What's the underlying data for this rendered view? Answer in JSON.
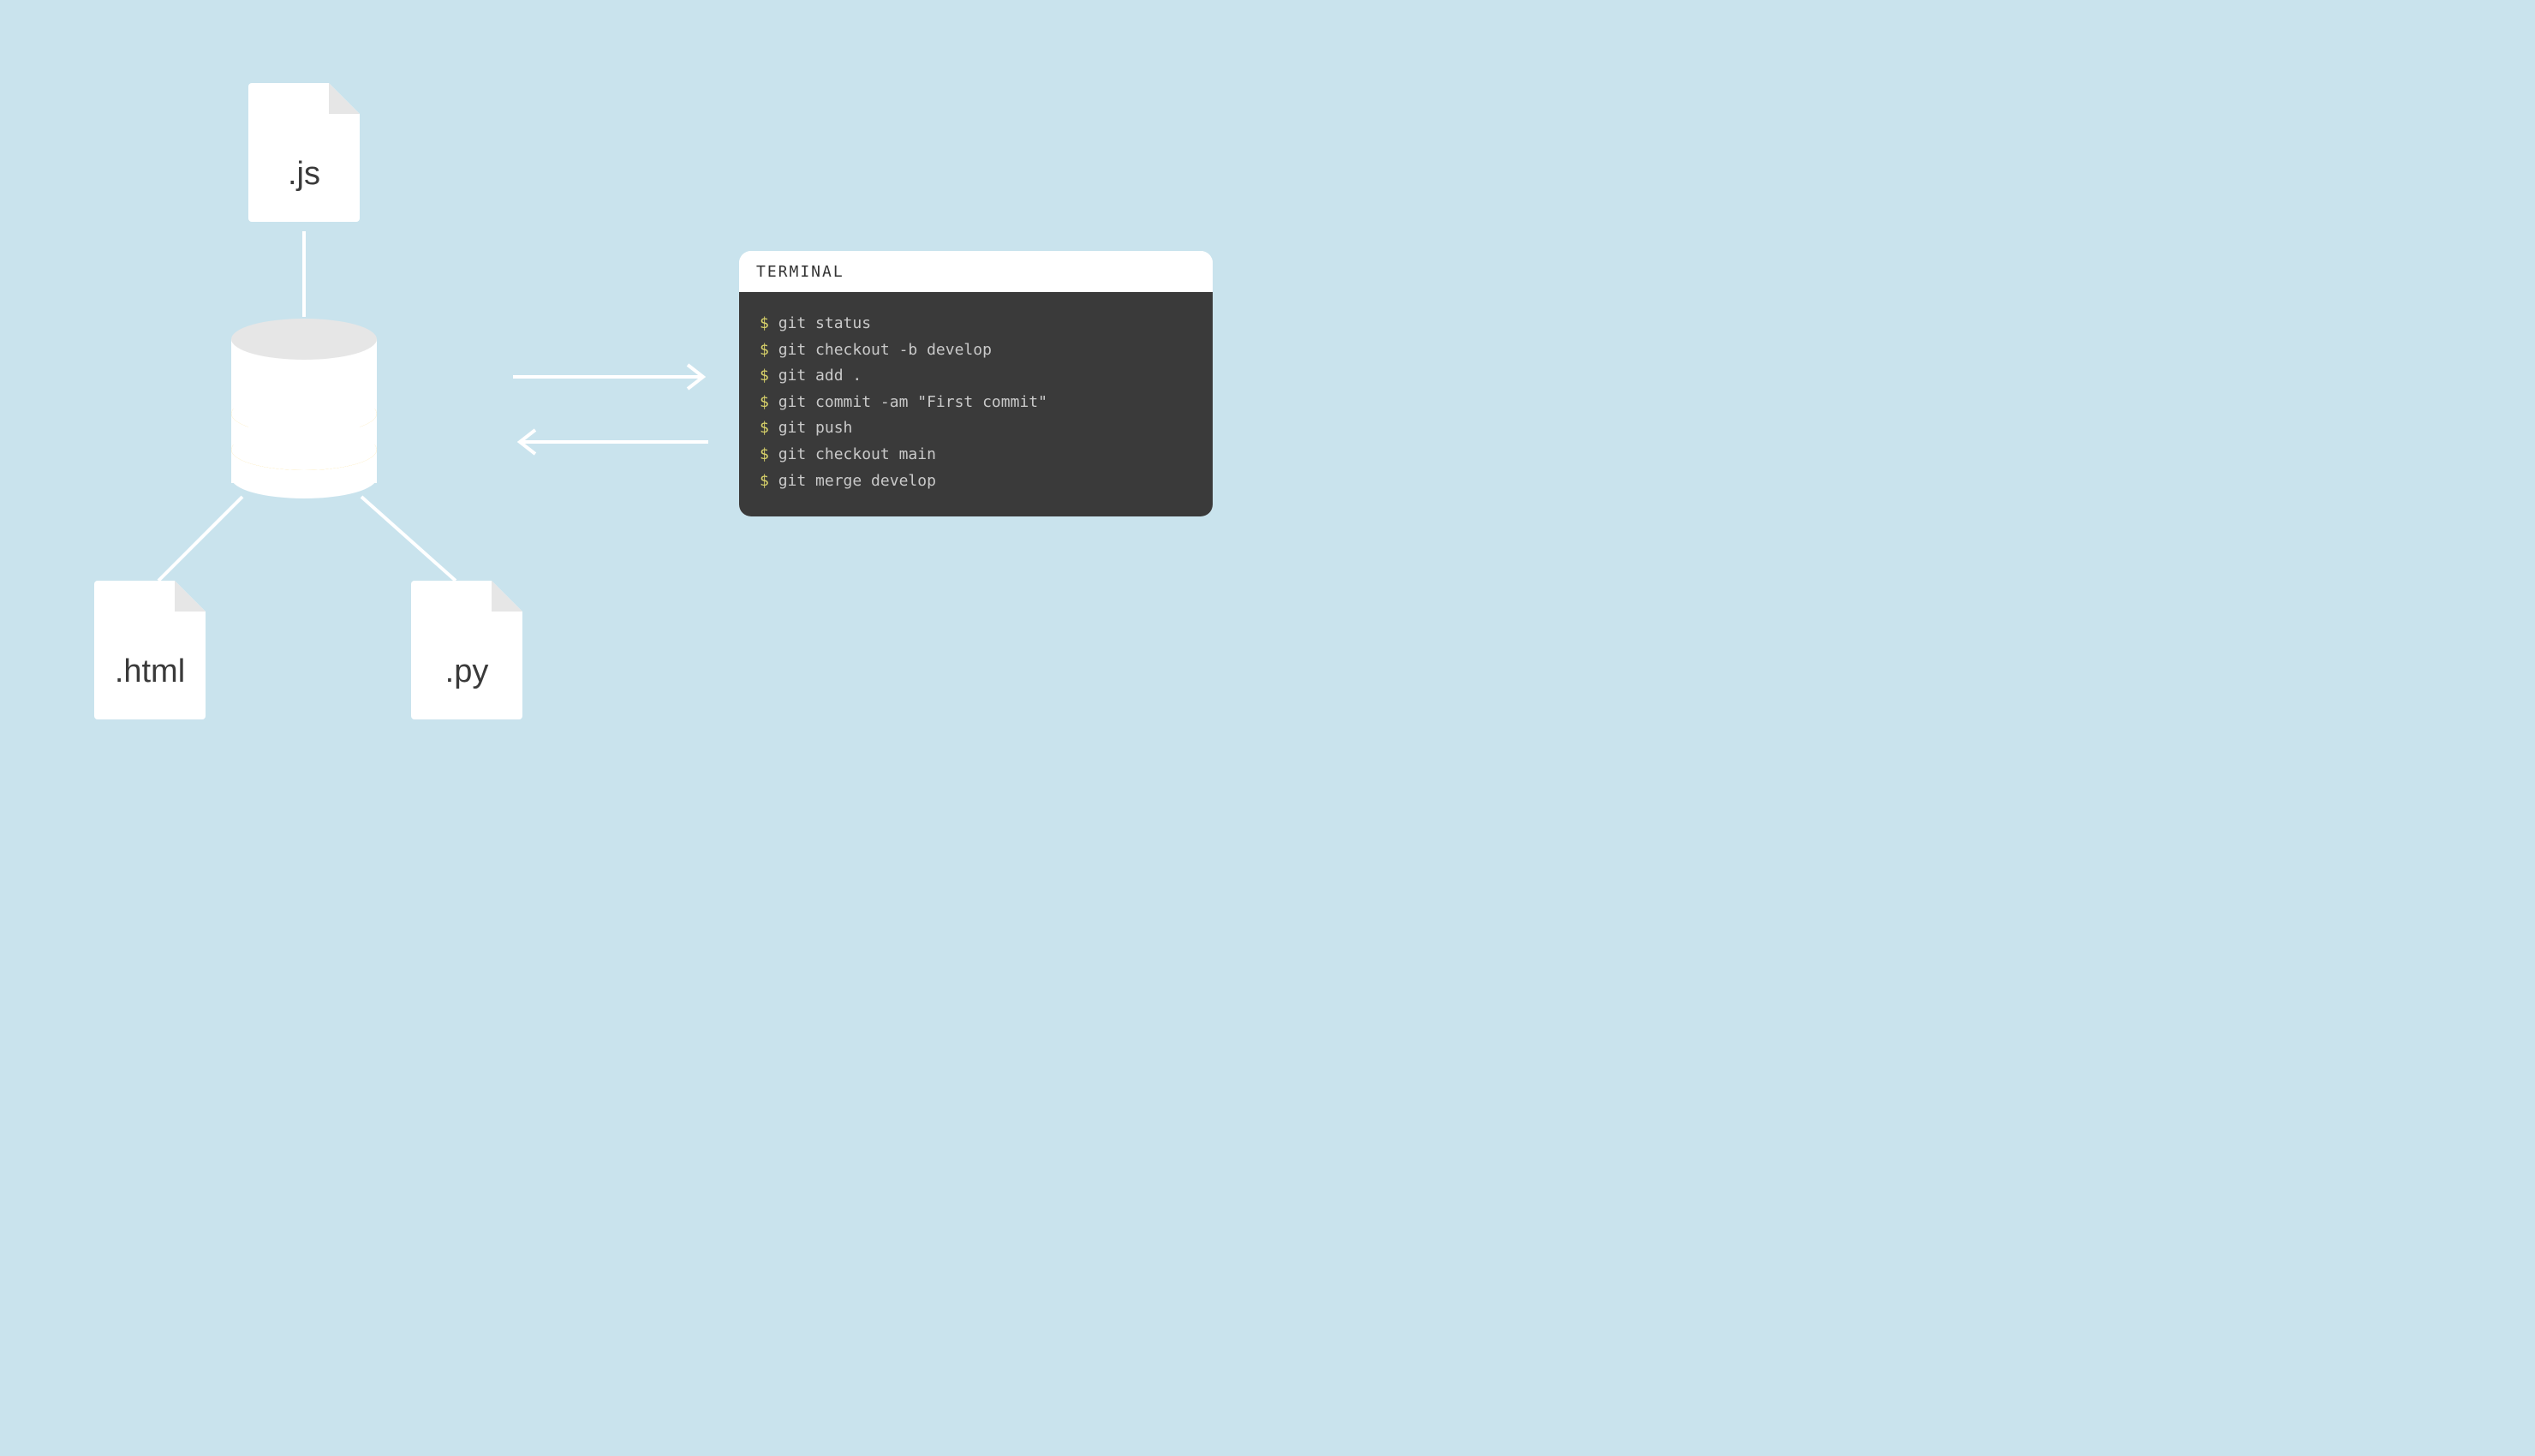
{
  "files": {
    "js": {
      "label": ".js"
    },
    "html": {
      "label": ".html"
    },
    "py": {
      "label": ".py"
    }
  },
  "terminal": {
    "title": "TERMINAL",
    "prompt": "$",
    "lines": [
      "git status",
      "git checkout -b develop",
      "git add .",
      "git commit -am \"First commit\"",
      "git push",
      "git checkout main",
      "git merge develop"
    ]
  }
}
